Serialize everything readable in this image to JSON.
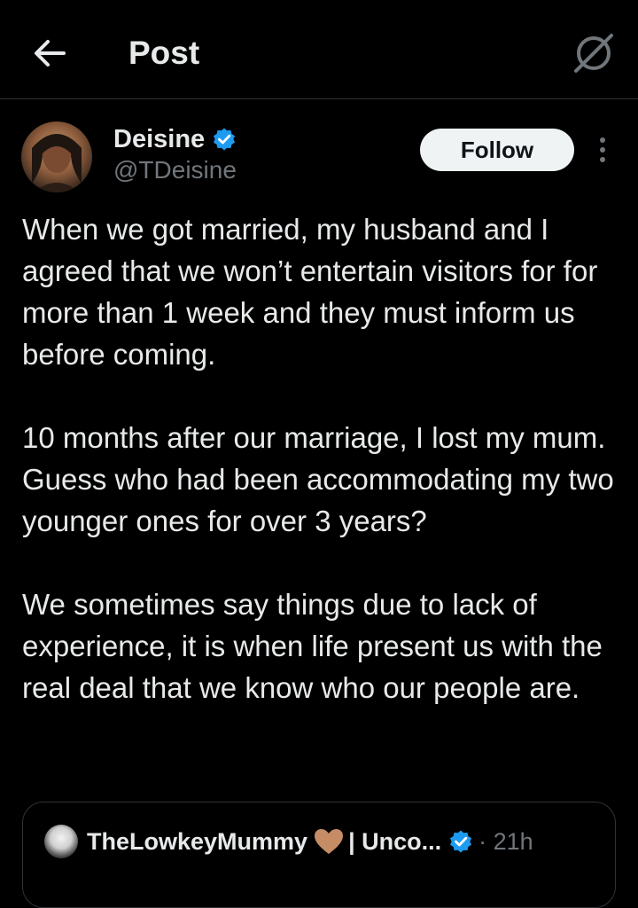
{
  "header": {
    "title": "Post",
    "back_icon": "arrow-left-icon",
    "grok_icon": "grok-icon"
  },
  "author": {
    "name": "Deisine",
    "handle": "@TDeisine",
    "verified": true,
    "verified_color": "#1d9bf0",
    "follow_label": "Follow"
  },
  "post": {
    "paragraphs": [
      "When we got married, my husband and I agreed that we won’t entertain visitors for for more than 1 week and they must inform us before coming.",
      "10 months after our marriage, I lost my mum. Guess who had been accommodating my two younger ones for over 3 years?",
      "We sometimes say things due to lack of experience, it is when life present us with the real deal that we know who our people are."
    ]
  },
  "quote": {
    "name": "TheLowkeyMummy",
    "name_suffix": "| Unco...",
    "verified": true,
    "time": "· 21h",
    "heart_color": "#c58c66"
  }
}
